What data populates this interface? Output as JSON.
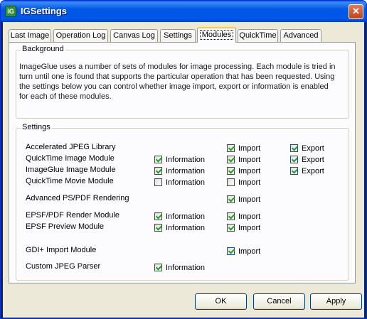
{
  "window": {
    "title": "IGSettings",
    "icon": "ig-app-icon",
    "close_glyph": "✕"
  },
  "tabs": [
    {
      "label": "Last Image",
      "active": false
    },
    {
      "label": "Operation Log",
      "active": false
    },
    {
      "label": "Canvas Log",
      "active": false
    },
    {
      "label": "Settings",
      "active": false
    },
    {
      "label": "Modules",
      "active": true
    },
    {
      "label": "QuickTime",
      "active": false
    },
    {
      "label": "Advanced",
      "active": false
    }
  ],
  "background": {
    "title": "Background",
    "text": "ImageGlue uses a number of sets of modules for image processing. Each module is tried in turn until one is found that supports the particular operation that has been requested. Using the settings below you can control whether image import, export or information is enabled for each of these modules."
  },
  "settings": {
    "title": "Settings",
    "labels": {
      "information": "Information",
      "import": "Import",
      "export": "Export"
    },
    "modules": [
      {
        "name": "Accelerated JPEG Library",
        "information": null,
        "import": true,
        "export": true
      },
      {
        "name": "QuickTime Image Module",
        "information": true,
        "import": true,
        "export": true
      },
      {
        "name": "ImageGlue Image Module",
        "information": true,
        "import": true,
        "export": true
      },
      {
        "name": "QuickTime Movie Module",
        "information": false,
        "import": false,
        "export": null
      },
      {
        "name": "Advanced PS/PDF Rendering",
        "information": null,
        "import": true,
        "export": null
      },
      {
        "name": "EPSF/PDF Render Module",
        "information": true,
        "import": true,
        "export": null
      },
      {
        "name": "EPSF Preview Module",
        "information": true,
        "import": true,
        "export": null
      },
      {
        "name": "GDI+ Import Module",
        "information": null,
        "import": true,
        "export": null
      },
      {
        "name": "Custom JPEG Parser",
        "information": true,
        "import": null,
        "export": null
      }
    ]
  },
  "buttons": {
    "ok": "OK",
    "cancel": "Cancel",
    "apply": "Apply"
  },
  "colors": {
    "title_bar": "#0055e5",
    "dialog_bg": "#ece9d8",
    "check": "#21a121",
    "active_tab_accent": "#ffc83c"
  }
}
